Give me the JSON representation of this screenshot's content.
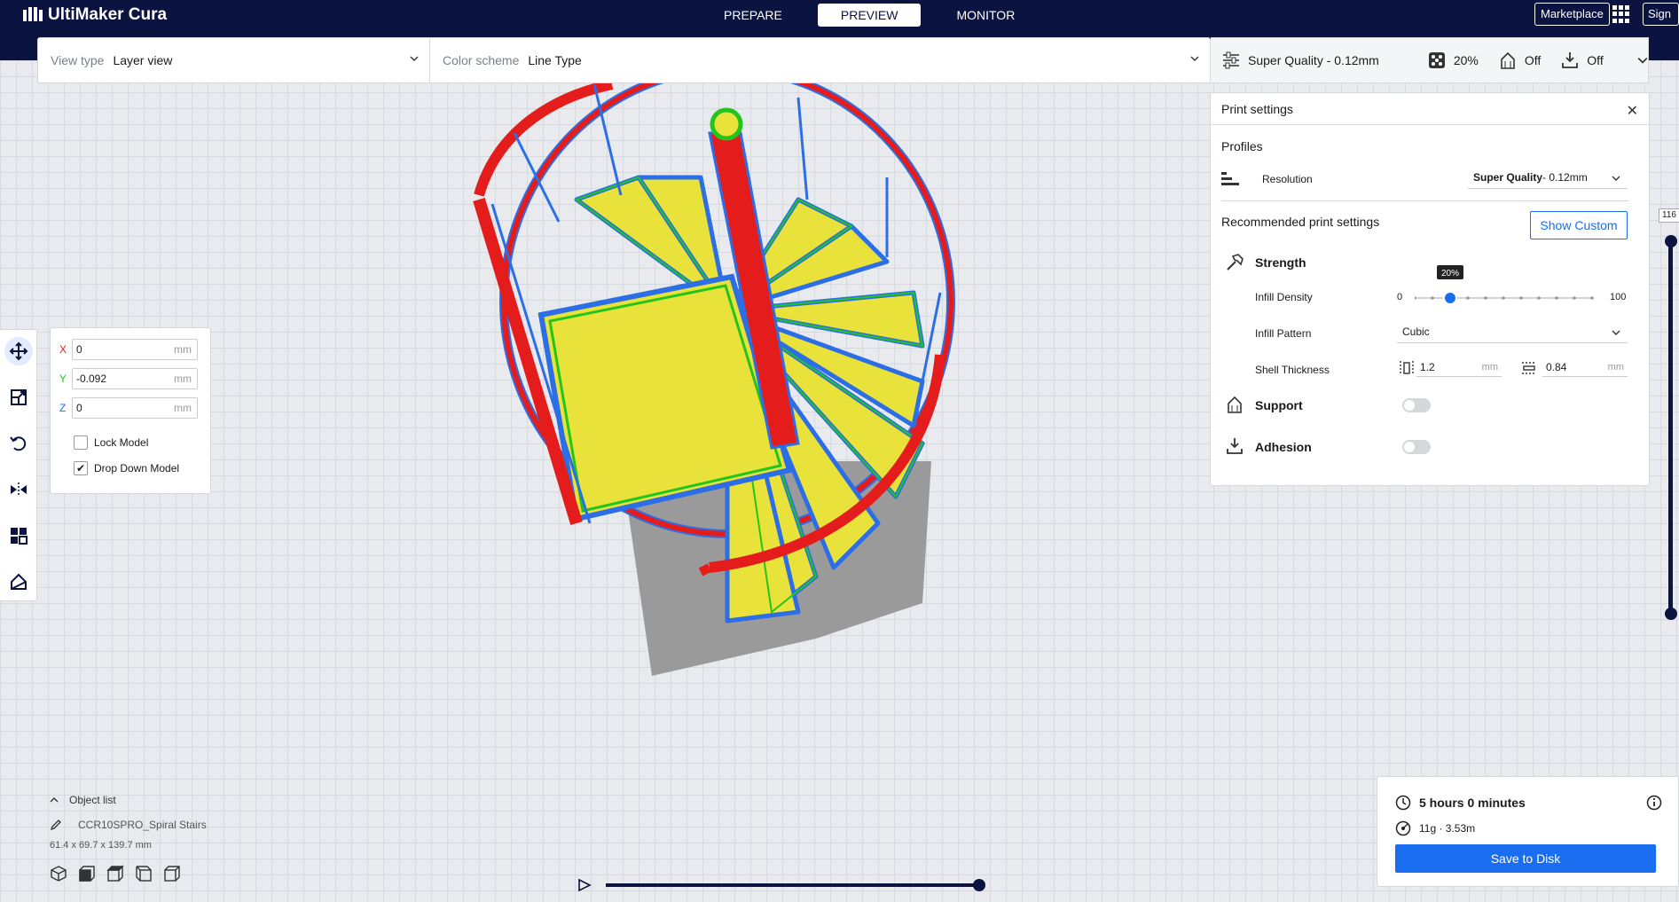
{
  "app": {
    "title": "UltiMaker Cura"
  },
  "stages": [
    "PREPARE",
    "PREVIEW",
    "MONITOR"
  ],
  "active_stage": "PREVIEW",
  "header": {
    "marketplace": "Marketplace",
    "sign_in": "Sign in"
  },
  "view_bar": {
    "view_type_label": "View type",
    "view_type_value": "Layer view",
    "color_scheme_label": "Color scheme",
    "color_scheme_value": "Line Type"
  },
  "summary": {
    "profile": "Super Quality - 0.12mm",
    "infill": "20%",
    "support": "Off",
    "adhesion": "Off"
  },
  "print_settings": {
    "title": "Print settings",
    "profiles_label": "Profiles",
    "resolution_label": "Resolution",
    "resolution_value_bold": "Super Quality",
    "resolution_value_rest": " - 0.12mm",
    "recommended_label": "Recommended print settings",
    "show_custom": "Show Custom",
    "strength_label": "Strength",
    "infill_density_label": "Infill Density",
    "infill_min": "0",
    "infill_max": "100",
    "infill_value": 20,
    "infill_tooltip": "20%",
    "infill_pattern_label": "Infill Pattern",
    "infill_pattern_value": "Cubic",
    "shell_thickness_label": "Shell Thickness",
    "wall_thickness": "1.2",
    "top_bottom_thickness": "0.84",
    "unit": "mm",
    "support_label": "Support",
    "support_on": false,
    "adhesion_label": "Adhesion",
    "adhesion_on": false
  },
  "move_panel": {
    "x_label": "X",
    "x_value": "0",
    "y_label": "Y",
    "y_value": "-0.092",
    "z_label": "Z",
    "z_value": "0",
    "unit": "mm",
    "lock_model": "Lock Model",
    "lock_model_checked": false,
    "drop_down_model": "Drop Down Model",
    "drop_down_model_checked": true
  },
  "object_list": {
    "title": "Object list",
    "item": "CCR10SPRO_Spiral Stairs",
    "dimensions": "61.4 x 69.7 x 139.7 mm"
  },
  "layer_slider": {
    "top_value": "116"
  },
  "output": {
    "time": "5 hours 0 minutes",
    "material": "11g · 3.53m",
    "save": "Save to Disk"
  },
  "colors": {
    "topbar": "#0b1341",
    "accent": "#196ef0",
    "wall_outer": "#e51c1c",
    "wall_inner": "#22c51e",
    "infill": "#e9e23a",
    "skin": "#2b6ee6"
  }
}
